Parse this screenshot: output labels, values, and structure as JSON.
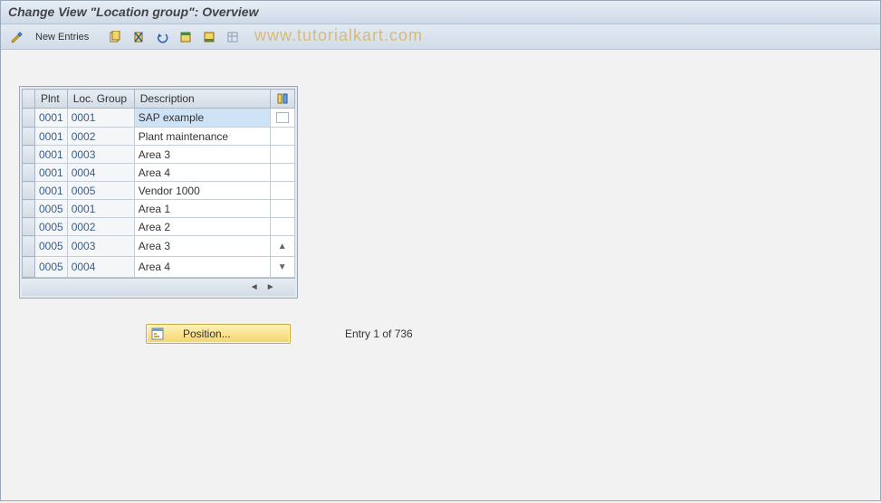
{
  "title": "Change View \"Location group\": Overview",
  "watermark": "www.tutorialkart.com",
  "toolbar": {
    "edit_label": "",
    "new_entries_label": "New Entries"
  },
  "table": {
    "columns": {
      "plnt": "Plnt",
      "locgroup": "Loc. Group",
      "description": "Description"
    },
    "rows": [
      {
        "plnt": "0001",
        "locg": "0001",
        "desc": "SAP example",
        "selected": true
      },
      {
        "plnt": "0001",
        "locg": "0002",
        "desc": "Plant maintenance",
        "selected": false
      },
      {
        "plnt": "0001",
        "locg": "0003",
        "desc": "Area 3",
        "selected": false
      },
      {
        "plnt": "0001",
        "locg": "0004",
        "desc": "Area 4",
        "selected": false
      },
      {
        "plnt": "0001",
        "locg": "0005",
        "desc": "Vendor 1000",
        "selected": false
      },
      {
        "plnt": "0005",
        "locg": "0001",
        "desc": "Area 1",
        "selected": false
      },
      {
        "plnt": "0005",
        "locg": "0002",
        "desc": "Area 2",
        "selected": false
      },
      {
        "plnt": "0005",
        "locg": "0003",
        "desc": "Area 3",
        "selected": false
      },
      {
        "plnt": "0005",
        "locg": "0004",
        "desc": "Area 4",
        "selected": false
      }
    ]
  },
  "position_button": "Position...",
  "entry_status": "Entry 1 of 736"
}
